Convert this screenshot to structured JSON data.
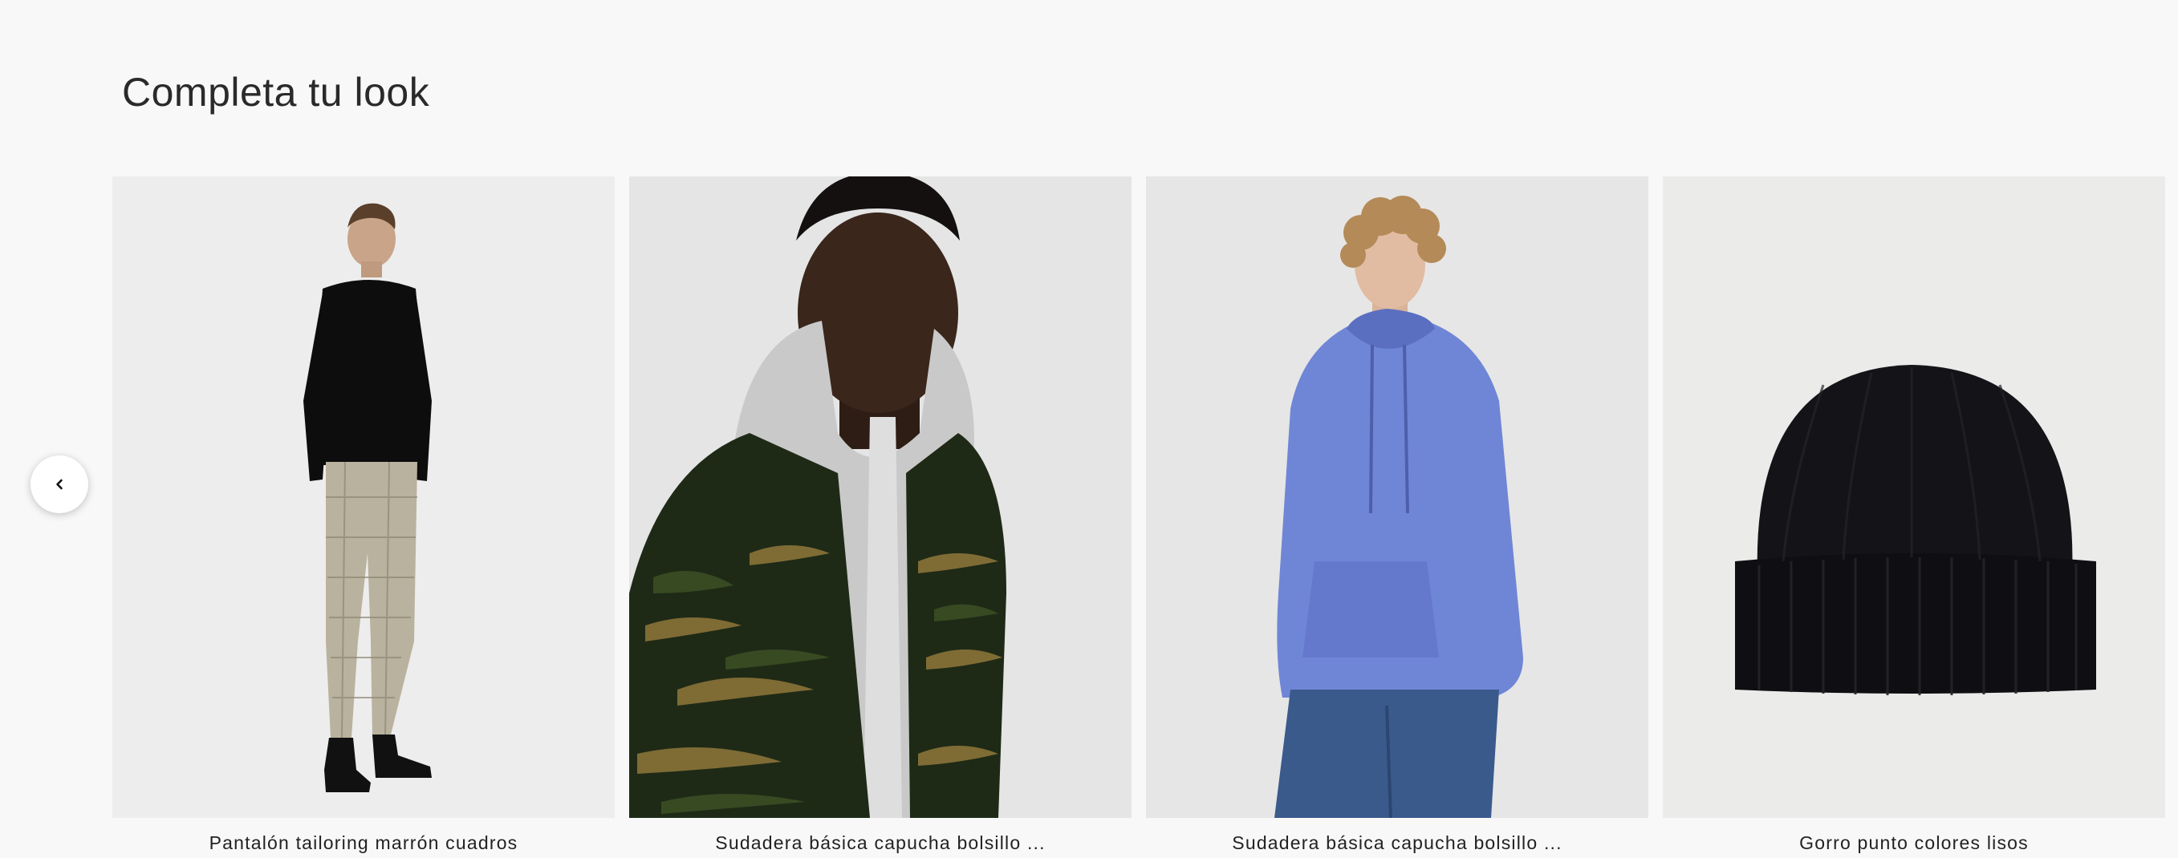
{
  "section": {
    "title": "Completa tu look"
  },
  "carousel": {
    "prev_icon": "chevron-left-icon",
    "products": [
      {
        "name": "Pantalón tailoring marrón cuadros",
        "image": "model-black-sweater-check-trousers"
      },
      {
        "name": "Sudadera básica capucha bolsillo ...",
        "image": "model-grey-hoodie-camo-jacket"
      },
      {
        "name": "Sudadera básica capucha bolsillo ...",
        "image": "model-blue-hoodie-jeans"
      },
      {
        "name": "Gorro punto colores lisos",
        "image": "black-knit-beanie"
      }
    ]
  },
  "colors": {
    "background": "#f8f8f8",
    "photo_bg_1": "#ececec",
    "photo_bg_2": "#e4e4e4",
    "photo_bg_3": "#e6e6e6",
    "photo_bg_4": "#ebebea",
    "hoodie_blue": "#6f86d6",
    "beanie_black": "#141418"
  }
}
